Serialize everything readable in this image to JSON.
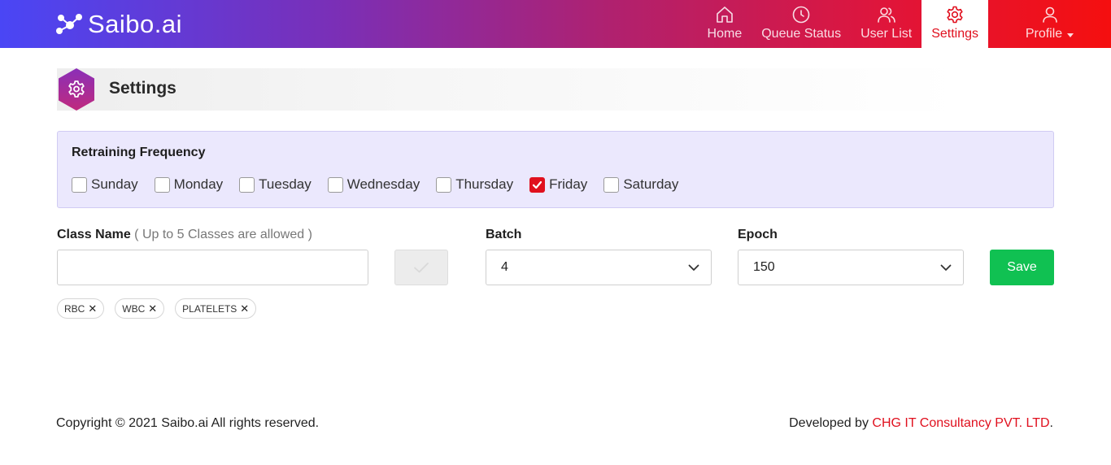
{
  "brand": {
    "name": "Saibo.ai"
  },
  "nav": {
    "items": [
      {
        "label": "Home",
        "icon": "home-icon"
      },
      {
        "label": "Queue Status",
        "icon": "clock-icon"
      },
      {
        "label": "User List",
        "icon": "users-icon"
      },
      {
        "label": "Settings",
        "icon": "gear-icon",
        "active": true
      },
      {
        "label": "Profile",
        "icon": "user-icon",
        "dropdown": true
      }
    ]
  },
  "page": {
    "title": "Settings",
    "icon": "gear-icon"
  },
  "retraining": {
    "title": "Retraining Frequency",
    "days": [
      {
        "label": "Sunday",
        "checked": false
      },
      {
        "label": "Monday",
        "checked": false
      },
      {
        "label": "Tuesday",
        "checked": false
      },
      {
        "label": "Wednesday",
        "checked": false
      },
      {
        "label": "Thursday",
        "checked": false
      },
      {
        "label": "Friday",
        "checked": true
      },
      {
        "label": "Saturday",
        "checked": false
      }
    ]
  },
  "form": {
    "class_name_label": "Class Name",
    "class_name_hint": "( Up to 5 Classes are allowed )",
    "class_name_value": "",
    "batch_label": "Batch",
    "batch_value": "4",
    "epoch_label": "Epoch",
    "epoch_value": "150",
    "save_label": "Save"
  },
  "classes": [
    "RBC",
    "WBC",
    "PLATELETS"
  ],
  "footer": {
    "copyright": "Copyright © 2021 Saibo.ai All rights reserved.",
    "developed_by": "Developed by",
    "company": "CHG IT Consultancy PVT. LTD",
    "suffix": "."
  },
  "colors": {
    "accent": "#e0101e",
    "save": "#10c152",
    "panel_bg": "#ebe8fd",
    "header_start": "#4a46f5",
    "header_end": "#f50f0f"
  }
}
